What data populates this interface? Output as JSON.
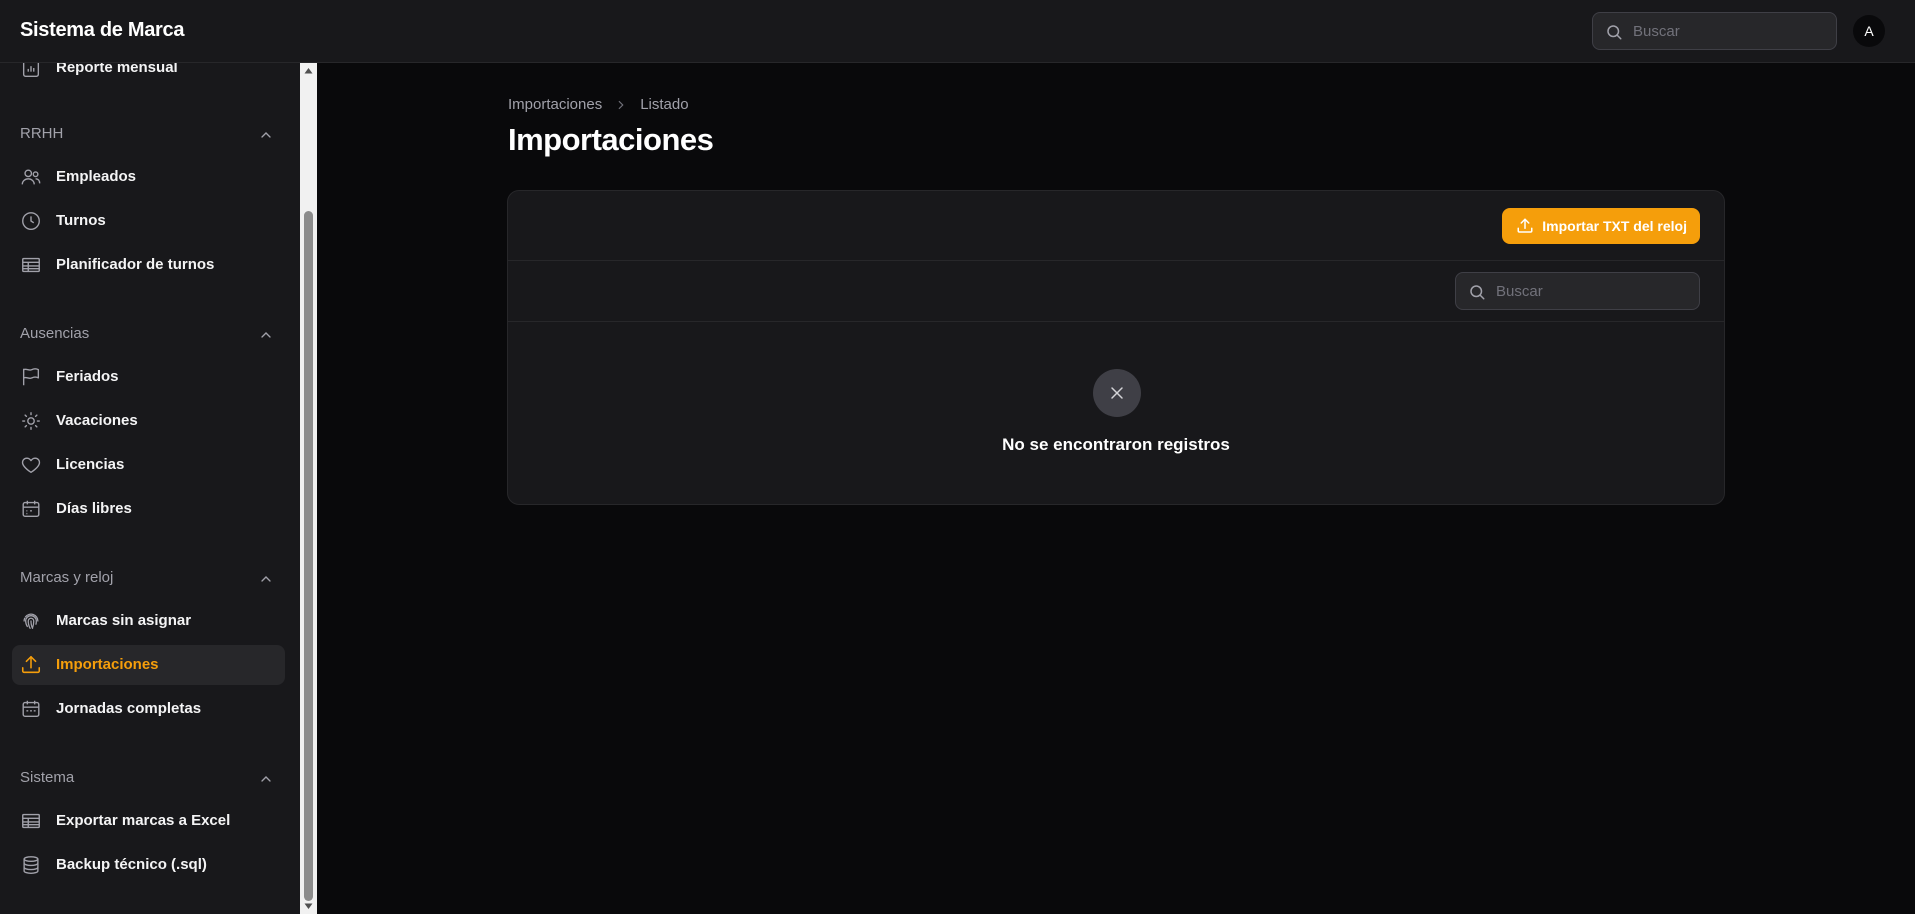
{
  "app": {
    "title": "Sistema de Marca",
    "avatar_initial": "A"
  },
  "topbar": {
    "search_placeholder": "Buscar"
  },
  "sidebar": {
    "partial_item": "Reporte mensual",
    "groups": [
      {
        "label": "RRHH",
        "items": [
          "Empleados",
          "Turnos",
          "Planificador de turnos"
        ]
      },
      {
        "label": "Ausencias",
        "items": [
          "Feriados",
          "Vacaciones",
          "Licencias",
          "Días libres"
        ]
      },
      {
        "label": "Marcas y reloj",
        "items": [
          "Marcas sin asignar",
          "Importaciones",
          "Jornadas completas"
        ]
      },
      {
        "label": "Sistema",
        "items": [
          "Exportar marcas a Excel",
          "Backup técnico (.sql)"
        ]
      }
    ],
    "active_item": "Importaciones",
    "accent_color": "#f59e0b"
  },
  "breadcrumb": {
    "root": "Importaciones",
    "current": "Listado"
  },
  "page": {
    "title": "Importaciones"
  },
  "table": {
    "import_button": "Importar TXT del reloj",
    "search_placeholder": "Buscar",
    "empty_message": "No se encontraron registros",
    "empty_icon": "x-icon"
  }
}
